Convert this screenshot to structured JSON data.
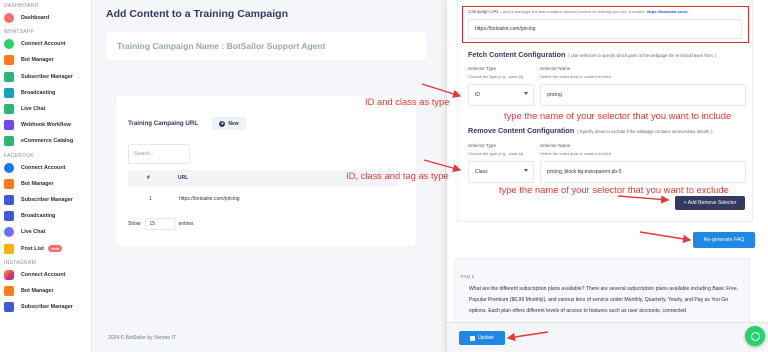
{
  "sidebar": {
    "sections": [
      {
        "label": "DASHBOARD",
        "items": [
          {
            "label": "Dashboard",
            "icon": "dashboard-icon"
          }
        ]
      },
      {
        "label": "WHATSAPP",
        "items": [
          {
            "label": "Connect Account",
            "icon": "connect-icon"
          },
          {
            "label": "Bot Manager",
            "icon": "bot-icon"
          },
          {
            "label": "Subscriber Manager",
            "icon": "subscriber-icon"
          },
          {
            "label": "Broadcasting",
            "icon": "broadcast-icon"
          },
          {
            "label": "Live Chat",
            "icon": "chat-icon"
          },
          {
            "label": "Webhook Workflow",
            "icon": "webhook-icon"
          },
          {
            "label": "eCommerce Catalog",
            "icon": "catalog-icon"
          }
        ]
      },
      {
        "label": "FACEBOOK",
        "items": [
          {
            "label": "Connect Account",
            "icon": "facebook-icon"
          },
          {
            "label": "Bot Manager",
            "icon": "bot-icon"
          },
          {
            "label": "Subscriber Manager",
            "icon": "subscriber-icon"
          },
          {
            "label": "Broadcasting",
            "icon": "broadcast-icon"
          },
          {
            "label": "Live Chat",
            "icon": "messenger-icon"
          },
          {
            "label": "Post List",
            "icon": "post-list-icon",
            "badge": "New"
          }
        ]
      },
      {
        "label": "INSTAGRAM",
        "items": [
          {
            "label": "Connect Account",
            "icon": "instagram-icon"
          },
          {
            "label": "Bot Manager",
            "icon": "bot-icon"
          },
          {
            "label": "Subscriber Manager",
            "icon": "subscriber-icon"
          }
        ]
      }
    ]
  },
  "main": {
    "page_title": "Add Content to a Training Campaign",
    "campaign_name": "Training Campaign Name : BotSailor Support Agent",
    "table": {
      "title": "Training Campaing URL",
      "new_button": "New",
      "search_placeholder": "Search...",
      "columns": [
        "#",
        "URL"
      ],
      "rows": [
        {
          "num": "1",
          "url": "https://botsailor.com/pricing"
        }
      ],
      "show_label": "Show",
      "show_value": "15",
      "entries_label": "entries"
    },
    "footer": "2024 © BotSailor by Xerone IT"
  },
  "panel": {
    "campaign_url_label": "Campaign URL",
    "campaign_url_hint": "( Add a webpage link that contains relevant content for training your bot. Example: ",
    "campaign_url_hint_link": "https://botsailor.com/",
    "campaign_url_hint_end": ")",
    "campaign_url_value": "https://botsailor.com/pricing",
    "fetch": {
      "title": "Fetch Content Configuration",
      "hint": "( Use selectors to specify which parts of the webpage the AI should learn from. )",
      "selector_type_label": "Selector Type",
      "selector_type_hint": "Choose the type (e.g., class,id).",
      "selector_name_label": "Selector Name",
      "selector_name_hint": "Define the exact area of content to fetch.",
      "selector_type_value": "ID",
      "selector_name_value": "pricing"
    },
    "remove": {
      "title": "Remove Content Configuration",
      "hint": "( Specify areas to exclude if the webpage contains unnecessary details. )",
      "selector_type_label": "Selector Type",
      "selector_type_hint": "Choose the type (e.g., class,id).",
      "selector_name_label": "Selector Name",
      "selector_name_hint": "Define the exact area of content to fetch.",
      "selector_type_value": "Class",
      "selector_name_value": "pricing_block bg-transparent pb-5"
    },
    "add_remove_selector_button": "+ Add Remove Selector",
    "regenerate_button": "Re-generate FAQ",
    "faq_label": "FAQ 1",
    "faq_text": "What are the different subscription plans available? There are several subscription plans available including Basic Free, Popular Premium ($6.99 Monthly), and various tiers of service under Monthly, Quarterly, Yearly, and Pay as You Go options. Each plan offers different levels of access to features such as user accounts, connected",
    "update_button": "Update"
  },
  "annotations": {
    "id_class_type": "ID and class as type",
    "include_hint": "type the name of your selector that you want to include",
    "id_class_tag_type": "ID, class and tag as type",
    "exclude_hint": "type the name of your selector that you want to exclude"
  },
  "colors": {
    "accent": "#34395e",
    "primary": "#1e88e5",
    "annotation": "#e53935",
    "whatsapp": "#25d366"
  }
}
